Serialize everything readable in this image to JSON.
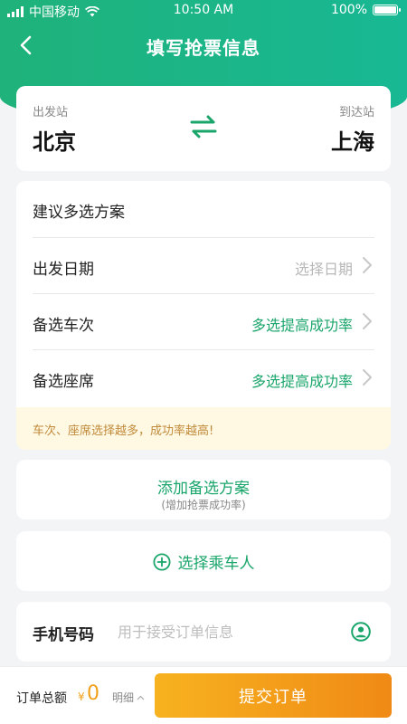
{
  "status_bar": {
    "carrier": "中国移动",
    "time": "10:50 AM",
    "battery": "100%"
  },
  "nav": {
    "title": "填写抢票信息"
  },
  "route": {
    "from_label": "出发站",
    "from_city": "北京",
    "to_label": "到达站",
    "to_city": "上海"
  },
  "options": {
    "heading": "建议多选方案",
    "rows": [
      {
        "label": "出发日期",
        "value": "选择日期"
      },
      {
        "label": "备选车次",
        "value": "多选提高成功率"
      },
      {
        "label": "备选座席",
        "value": "多选提高成功率"
      }
    ],
    "tip": "车次、座席选择越多，成功率越高!"
  },
  "add_plan": {
    "title": "添加备选方案",
    "subtitle": "(增加抢票成功率)"
  },
  "passenger": {
    "label": "选择乘车人"
  },
  "phone": {
    "label": "手机号码",
    "placeholder": "用于接受订单信息"
  },
  "bottom": {
    "total_label": "订单总额",
    "currency": "¥",
    "amount": "0",
    "detail": "明细",
    "submit": "提交订单"
  },
  "colors": {
    "brand_green": "#1aa56b",
    "accent_orange": "#f08a16",
    "tip_bg": "#fff8e3"
  },
  "icons": [
    "back-arrow-icon",
    "swap-arrows-icon",
    "chevron-right-icon",
    "plus-circle-icon",
    "contact-icon",
    "chevron-up-icon",
    "wifi-icon",
    "signal-icon",
    "battery-icon"
  ]
}
